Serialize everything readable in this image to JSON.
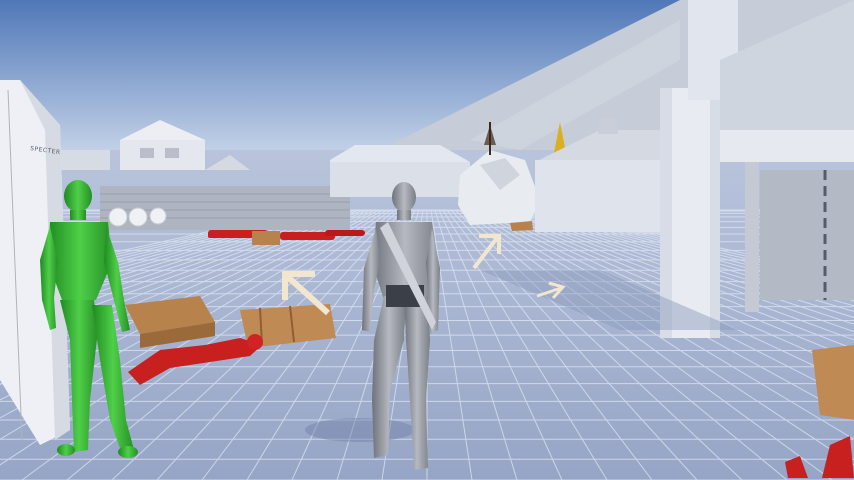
{
  "scene": {
    "wall_sign": "SPECTER",
    "colors": {
      "sky_top": "#4f78b8",
      "sky_horizon": "#c9d6ea",
      "ground": "#a7b4cf",
      "grid_line": "#dfe6f4",
      "architecture": "#dfe4ee",
      "player": "#9a9ea6",
      "ally": "#39b43a",
      "enemy": "#c81f1f",
      "crate": "#b8824d",
      "arrow": "#f2e6cf"
    },
    "characters": [
      {
        "role": "player",
        "state": "standing"
      },
      {
        "role": "ally",
        "state": "standing"
      },
      {
        "role": "enemy",
        "state": "downed"
      },
      {
        "role": "enemy",
        "state": "downed"
      },
      {
        "role": "enemy",
        "state": "downed"
      }
    ],
    "waypoint_arrows": [
      {
        "direction": "up-left"
      },
      {
        "direction": "up-right"
      },
      {
        "direction": "right"
      }
    ]
  }
}
